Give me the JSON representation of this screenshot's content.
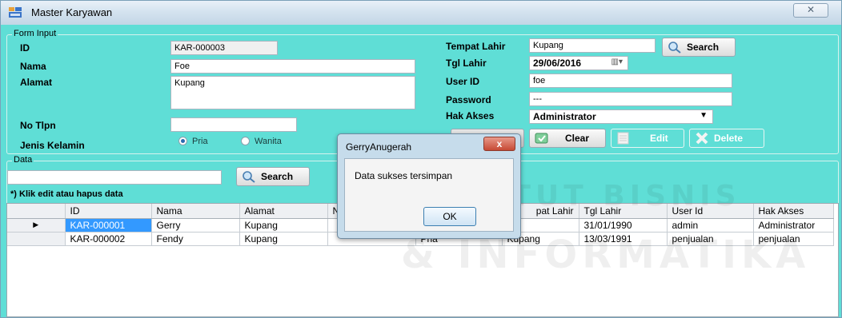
{
  "window": {
    "title": "Master Karyawan",
    "close_glyph": "✕"
  },
  "form": {
    "group_label": "Form Input",
    "id_label": "ID",
    "id_value": "KAR-000003",
    "nama_label": "Nama",
    "nama_value": "Foe",
    "alamat_label": "Alamat",
    "alamat_value": "Kupang",
    "notlpn_label": "No Tlpn",
    "notlpn_value": "",
    "jk_label": "Jenis Kelamin",
    "jk_pria": "Pria",
    "jk_wanita": "Wanita",
    "jk_selected": "Pria",
    "tempat_label": "Tempat Lahir",
    "tempat_value": "Kupang",
    "tgl_label": "Tgl Lahir",
    "tgl_value": "29/06/2016",
    "userid_label": "User ID",
    "userid_value": "foe",
    "password_label": "Password",
    "password_value": "---",
    "hak_label": "Hak Akses",
    "hak_value": "Administrator",
    "search_label": "Search"
  },
  "buttons": {
    "clear": "Clear",
    "edit": "Edit",
    "delete": "Delete"
  },
  "data": {
    "group_label": "Data",
    "search_label": "Search",
    "hint": "*) Klik edit atau hapus data",
    "columns": [
      "ID",
      "Nama",
      "Alamat",
      "No",
      "",
      "pat Lahir",
      "Tgl Lahir",
      "User Id",
      "Hak Akses"
    ],
    "rows": [
      {
        "cells": [
          "KAR-000001",
          "Gerry",
          "Kupang",
          "",
          "",
          "ng",
          "31/01/1990",
          "admin",
          "Administrator"
        ],
        "selected": true
      },
      {
        "cells": [
          "KAR-000002",
          "Fendy",
          "Kupang",
          "",
          "Pria",
          "Kupang",
          "13/03/1991",
          "penjualan",
          "penjualan"
        ],
        "selected": false
      }
    ]
  },
  "dialog": {
    "title": "GerryAnugerah",
    "message": "Data sukses tersimpan",
    "ok": "OK",
    "close_glyph": "x"
  },
  "watermark": {
    "line1": "INSTITUT BISNIS",
    "line2": "& INFORMATIKA"
  },
  "colors": {
    "window_bg": "#5fded6",
    "selection": "#3399ff",
    "grid_header": "#eef0f3"
  }
}
